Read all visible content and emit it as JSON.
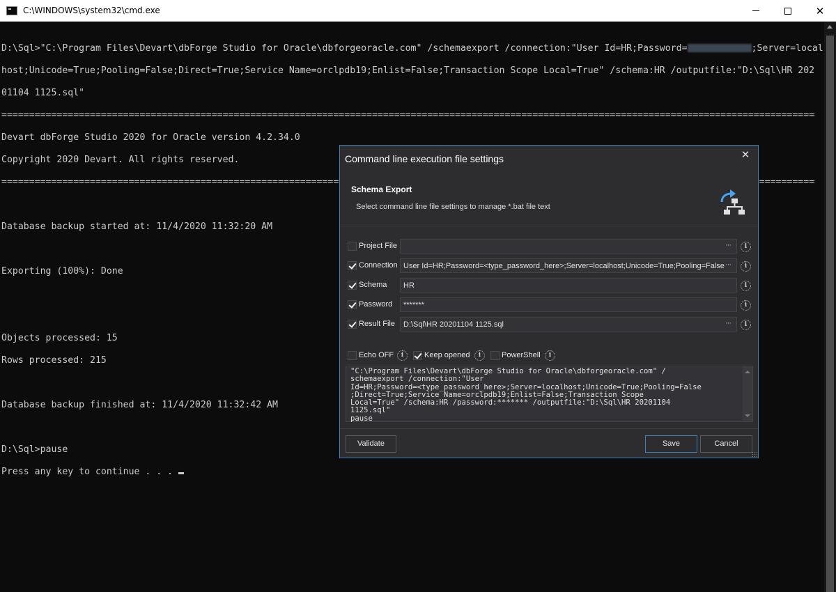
{
  "window": {
    "title": "C:\\WINDOWS\\system32\\cmd.exe"
  },
  "console": {
    "line1_pre": "D:\\Sql>\"C:\\Program Files\\Devart\\dbForge Studio for Oracle\\dbforgeoracle.com\" /schemaexport /connection:\"User Id=HR;Password=",
    "line1_post": ";Server=local",
    "line2": "host;Unicode=True;Pooling=False;Direct=True;Service Name=orclpdb19;Enlist=False;Transaction Scope Local=True\" /schema:HR /outputfile:\"D:\\Sql\\HR 202",
    "line3": "01104 1125.sql\"",
    "separator1": "=====================================================================================================================================================",
    "version": "Devart dbForge Studio 2020 for Oracle version 4.2.34.0",
    "copyright": "Copyright 2020 Devart. All rights reserved.",
    "separator2": "=====================================================================================================================================================",
    "backup_started": "Database backup started at: 11/4/2020 11:32:20 AM",
    "exporting": "Exporting (100%): Done",
    "objects": "Objects processed: 15",
    "rows": "Rows processed: 215",
    "backup_finished": "Database backup finished at: 11/4/2020 11:32:42 AM",
    "pause_cmd": "D:\\Sql>pause",
    "press_key": "Press any key to continue . . . "
  },
  "dialog": {
    "title": "Command line execution file settings",
    "close_glyph": "✕",
    "header_title": "Schema Export",
    "header_subtitle": "Select command line file settings to manage *.bat file text",
    "fields": [
      {
        "label": "Project File",
        "value": "",
        "checked": false
      },
      {
        "label": "Connection",
        "value": "User Id=HR;Password=<type_password_here>;Server=localhost;Unicode=True;Pooling=False",
        "checked": true
      },
      {
        "label": "Schema",
        "value": "HR",
        "checked": true
      },
      {
        "label": "Password",
        "value": "*******",
        "checked": true
      },
      {
        "label": "Result File",
        "value": "D:\\Sql\\HR 20201104 1125.sql",
        "checked": true
      }
    ],
    "ellipsis": "···",
    "info_glyph": "i",
    "options": {
      "echo_off": "Echo OFF",
      "keep_opened": "Keep opened",
      "powershell": "PowerShell"
    },
    "command_text": "\"C:\\Program Files\\Devart\\dbForge Studio for Oracle\\dbforgeoracle.com\" /\nschemaexport /connection:\"User\nId=HR;Password=<type_password_here>;Server=localhost;Unicode=True;Pooling=False\n;Direct=True;Service Name=orclpdb19;Enlist=False;Transaction Scope\nLocal=True\" /schema:HR /password:******* /outputfile:\"D:\\Sql\\HR 20201104\n1125.sql\"\npause",
    "buttons": {
      "validate": "Validate",
      "save": "Save",
      "cancel": "Cancel"
    }
  },
  "colors": {
    "accent": "#3a7fc0",
    "console_bg": "#0c0c0c",
    "console_text": "#cccccc",
    "dialog_bg": "#2d2d30"
  }
}
